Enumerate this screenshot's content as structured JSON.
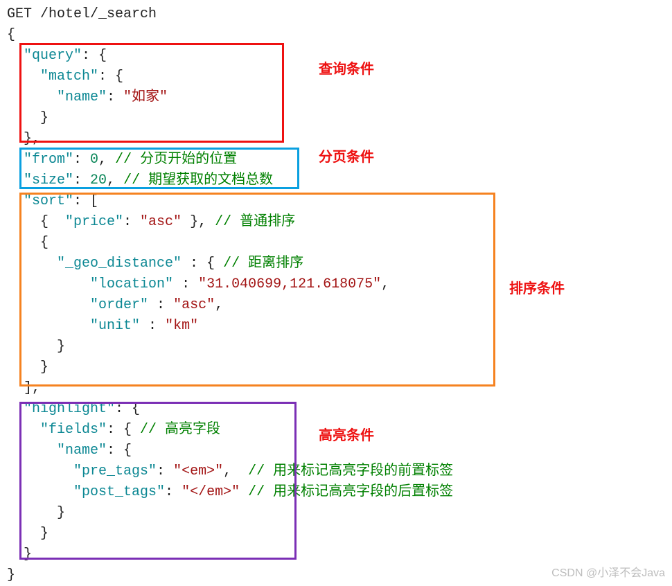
{
  "request_line": "GET /hotel/_search",
  "query": {
    "key": "\"query\"",
    "match_key": "\"match\"",
    "name_key": "\"name\"",
    "name_value": "\"如家\""
  },
  "from_key": "\"from\"",
  "from_value": "0",
  "from_comment": "// 分页开始的位置",
  "size_key": "\"size\"",
  "size_value": "20",
  "size_comment": "// 期望获取的文档总数",
  "sort_key": "\"sort\"",
  "price_key": "\"price\"",
  "price_value": "\"asc\"",
  "price_comment": "// 普通排序",
  "geo_key": "\"_geo_distance\"",
  "geo_comment": "// 距离排序",
  "location_key": "\"location\"",
  "location_value": "\"31.040699,121.618075\"",
  "order_key": "\"order\"",
  "order_value": "\"asc\"",
  "unit_key": "\"unit\"",
  "unit_value": "\"km\"",
  "highlight_key": "\"highlight\"",
  "fields_key": "\"fields\"",
  "fields_comment": "// 高亮字段",
  "hl_name_key": "\"name\"",
  "pre_tags_key": "\"pre_tags\"",
  "pre_tags_value": "\"<em>\"",
  "pre_tags_comment": "// 用来标记高亮字段的前置标签",
  "post_tags_key": "\"post_tags\"",
  "post_tags_value": "\"</em>\"",
  "post_tags_comment": "// 用来标记高亮字段的后置标签",
  "labels": {
    "query": "查询条件",
    "page": "分页条件",
    "sort": "排序条件",
    "highlight": "高亮条件"
  },
  "watermark": "CSDN @小泽不会Java"
}
